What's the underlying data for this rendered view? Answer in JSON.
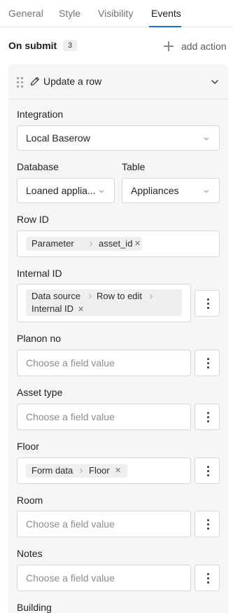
{
  "tabs": {
    "general": "General",
    "style": "Style",
    "visibility": "Visibility",
    "events": "Events",
    "active": "Events"
  },
  "header": {
    "title": "On submit",
    "count": "3",
    "add_action": "add action"
  },
  "action_card": {
    "title": "Update a row",
    "fields": {
      "integration": {
        "label": "Integration",
        "value": "Local Baserow"
      },
      "database": {
        "label": "Database",
        "value": "Loaned applia..."
      },
      "table": {
        "label": "Table",
        "value": "Appliances"
      },
      "row_id": {
        "label": "Row ID",
        "chip": [
          "Parameter",
          "asset_id"
        ]
      },
      "internal_id": {
        "label": "Internal ID",
        "chip_line1": [
          "Data source",
          "Row to edit"
        ],
        "chip_line2": "Internal ID"
      },
      "planon_no": {
        "label": "Planon no",
        "placeholder": "Choose a field value"
      },
      "asset_type": {
        "label": "Asset type",
        "placeholder": "Choose a field value"
      },
      "floor": {
        "label": "Floor",
        "chip": [
          "Form data",
          "Floor"
        ]
      },
      "room": {
        "label": "Room",
        "placeholder": "Choose a field value"
      },
      "notes": {
        "label": "Notes",
        "placeholder": "Choose a field value"
      },
      "building": {
        "label": "Building"
      }
    }
  },
  "icons": {
    "drag": "drag-handle-icon",
    "edit": "pencil-icon",
    "collapse": "chevron-down-icon",
    "add": "plus-icon",
    "more": "vertical-dots-icon",
    "remove": "close-icon"
  },
  "colors": {
    "accent": "#1e6bd6",
    "card_bg": "#f6f6f6",
    "chip_bg": "#efefef",
    "placeholder": "#8d8d8d"
  }
}
